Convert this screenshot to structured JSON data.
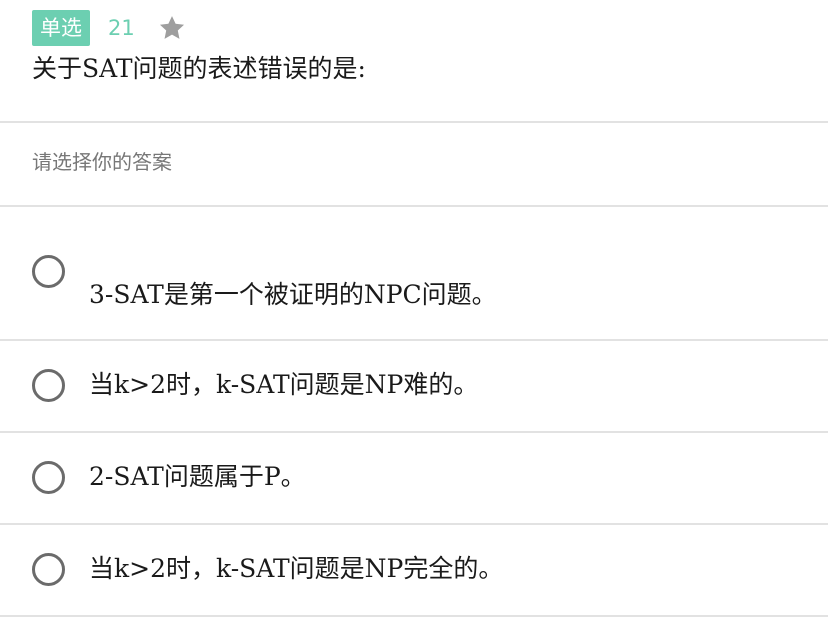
{
  "question": {
    "type_label": "单选",
    "number": "21",
    "star_icon": "star-icon",
    "text": "关于SAT问题的表述错误的是:"
  },
  "prompt": "请选择你的答案",
  "options": [
    {
      "label": "3-SAT是第一个被证明的NPC问题。"
    },
    {
      "label": "当k>2时，k-SAT问题是NP难的。"
    },
    {
      "label": "2-SAT问题属于P。"
    },
    {
      "label": "当k>2时，k-SAT问题是NP完全的。"
    }
  ],
  "colors": {
    "accent": "#6ccfb1",
    "radio_border": "#6b6b6b",
    "divider": "#e2e2e2",
    "prompt_text": "#777777",
    "star": "#9e9e9e"
  }
}
